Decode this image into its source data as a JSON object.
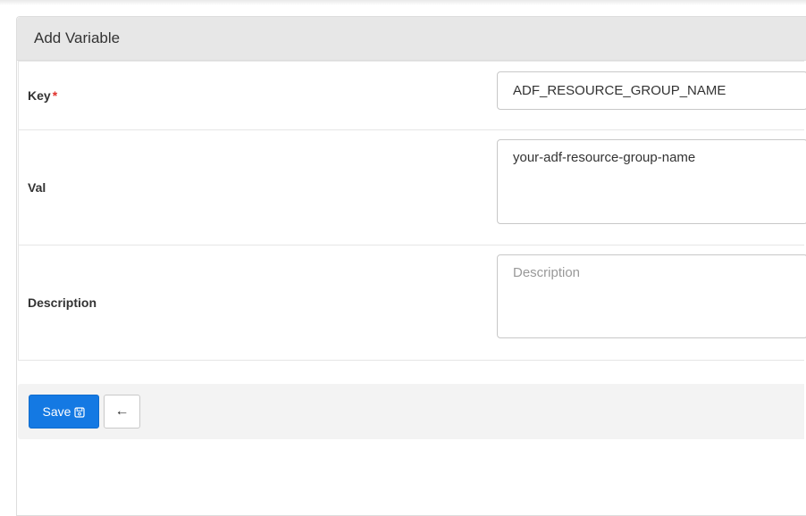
{
  "panel": {
    "title": "Add Variable"
  },
  "form": {
    "key": {
      "label": "Key",
      "required_marker": "*",
      "value": "ADF_RESOURCE_GROUP_NAME"
    },
    "val": {
      "label": "Val",
      "value": "your-adf-resource-group-name"
    },
    "description": {
      "label": "Description",
      "value": "",
      "placeholder": "Description"
    }
  },
  "actions": {
    "save_label": "Save",
    "save_icon": "floppy-disk-icon",
    "back_icon": "arrow-left-icon",
    "back_glyph": "←"
  },
  "colors": {
    "primary": "#1479e3",
    "required": "#e0312b",
    "header_bg": "#e7e7e7"
  }
}
